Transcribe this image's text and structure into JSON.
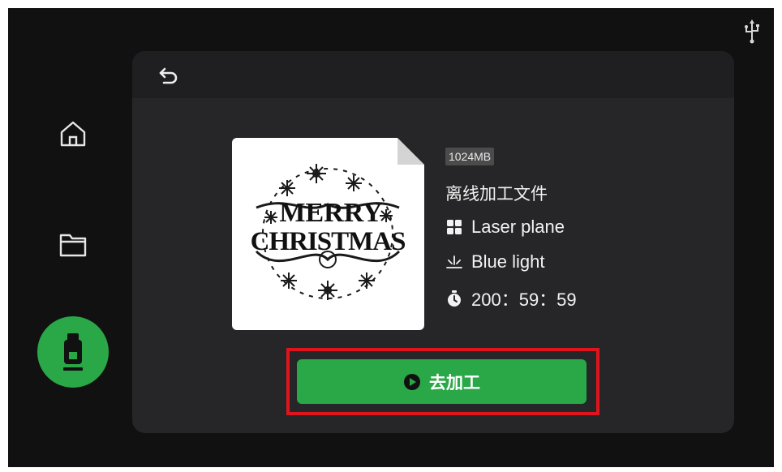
{
  "thumbnail": {
    "line1": "MERRY",
    "line2": "CHRISTMAS"
  },
  "file": {
    "size": "1024MB",
    "name": "离线加工文件",
    "mode": "Laser plane",
    "light": "Blue light",
    "time": "200：59：59"
  },
  "actions": {
    "start_label": "去加工"
  },
  "icons": {
    "usb_status": "usb-icon",
    "home": "home-icon",
    "folder": "folder-icon",
    "usb_drive": "usb-drive-icon",
    "back": "back-icon",
    "mode": "grid-icon",
    "light": "light-icon",
    "timer": "timer-icon",
    "play": "play-icon"
  },
  "colors": {
    "accent": "#2aa746",
    "highlight": "#e0141c",
    "background": "#111111",
    "panel": "#262628"
  }
}
